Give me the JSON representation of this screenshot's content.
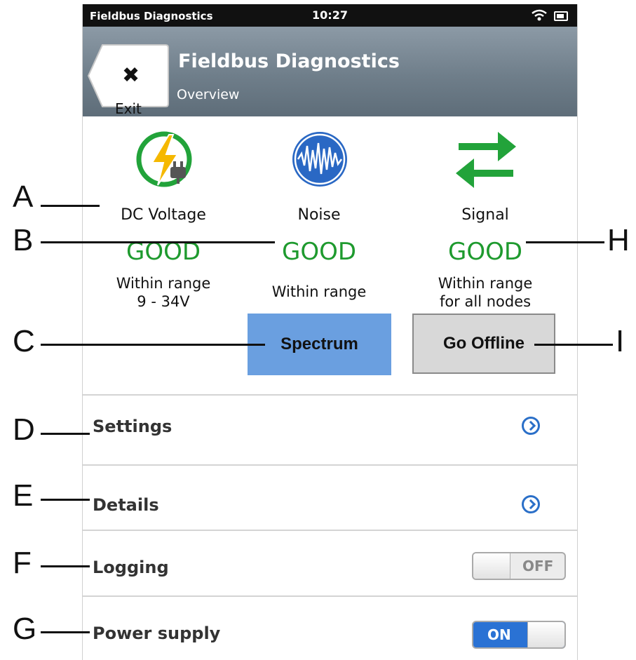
{
  "status_bar": {
    "app_name": "Fieldbus Diagnostics",
    "time": "10:27"
  },
  "header": {
    "exit_label": "Exit",
    "title": "Fieldbus Diagnostics",
    "subtitle": "Overview"
  },
  "metrics": [
    {
      "name": "DC Voltage",
      "state": "GOOD",
      "desc_line1": "Within range",
      "desc_line2": "9 - 34V"
    },
    {
      "name": "Noise",
      "state": "GOOD",
      "desc_line1": "Within range",
      "desc_line2": ""
    },
    {
      "name": "Signal",
      "state": "GOOD",
      "desc_line1": "Within range",
      "desc_line2": "for all nodes"
    }
  ],
  "buttons": {
    "spectrum": "Spectrum",
    "go_offline": "Go Offline"
  },
  "rows": {
    "settings": "Settings",
    "details": "Details",
    "logging": {
      "label": "Logging",
      "toggle": "OFF"
    },
    "power_supply": {
      "label": "Power supply",
      "toggle": "ON"
    }
  },
  "callouts": [
    "A",
    "B",
    "C",
    "D",
    "E",
    "F",
    "G",
    "H",
    "I"
  ],
  "colors": {
    "good": "#1e9a2e",
    "accent": "#2a72d4",
    "spectrum_button": "#6a9fe0"
  }
}
